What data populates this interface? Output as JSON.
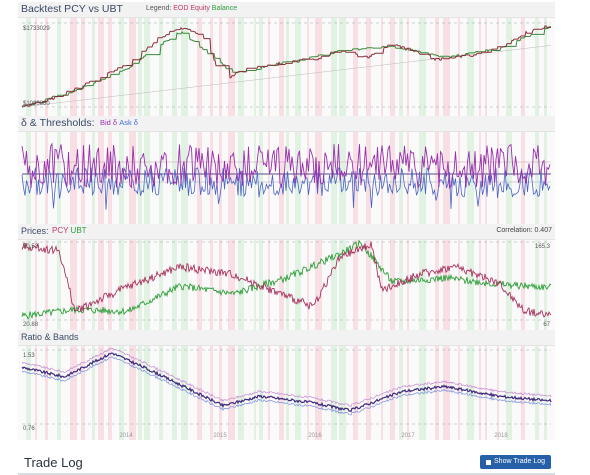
{
  "panels": {
    "backtest": {
      "title": "Backtest PCY vs UBT",
      "legend_prefix": "Legend:",
      "legend_a": "EOD Equity",
      "legend_b": "Balance",
      "top_value": "$1733029",
      "bottom_value": "$1000000"
    },
    "thresholds": {
      "title": "δ & Thresholds:",
      "legend_a": "Bid δ",
      "legend_b": "Ask δ"
    },
    "prices": {
      "title": "Prices:",
      "legend_a": "PCY",
      "legend_b": "UBT",
      "correlation": "Correlation: 0.407",
      "left_top": "30.53",
      "left_bottom": "20.88",
      "right_top": "165.3",
      "right_bottom": "67"
    },
    "ratio": {
      "title": "Ratio & Bands",
      "top_value": "1.53",
      "bottom_value": "0.76"
    }
  },
  "x_axis": {
    "years": [
      "2014",
      "2015",
      "2016",
      "2017",
      "2018"
    ]
  },
  "trade_log": {
    "title": "Trade Log",
    "button": "Show Trade Log"
  },
  "colors": {
    "pcy": "#a8325f",
    "ubt": "#2e9e3a",
    "bid": "#9b2fae",
    "ask": "#4a63c4",
    "equity": "#8b2f3a",
    "balance": "#3a8a3a"
  },
  "chart_data": [
    {
      "type": "line",
      "title": "Backtest PCY vs UBT",
      "series": [
        {
          "name": "EOD Equity",
          "points": [
            [
              0,
              1.0
            ],
            [
              0.05,
              1.06
            ],
            [
              0.12,
              1.2
            ],
            [
              0.2,
              1.38
            ],
            [
              0.26,
              1.62
            ],
            [
              0.3,
              1.71
            ],
            [
              0.34,
              1.65
            ],
            [
              0.36,
              1.45
            ],
            [
              0.38,
              1.24
            ],
            [
              0.42,
              1.33
            ],
            [
              0.5,
              1.4
            ],
            [
              0.56,
              1.44
            ],
            [
              0.6,
              1.51
            ],
            [
              0.65,
              1.44
            ],
            [
              0.7,
              1.56
            ],
            [
              0.74,
              1.5
            ],
            [
              0.78,
              1.42
            ],
            [
              0.85,
              1.46
            ],
            [
              0.9,
              1.53
            ],
            [
              0.95,
              1.66
            ],
            [
              1.0,
              1.73
            ]
          ]
        },
        {
          "name": "Balance",
          "points": [
            [
              0,
              1.0
            ],
            [
              0.1,
              1.15
            ],
            [
              0.2,
              1.35
            ],
            [
              0.3,
              1.68
            ],
            [
              0.4,
              1.3
            ],
            [
              0.5,
              1.4
            ],
            [
              0.6,
              1.5
            ],
            [
              0.7,
              1.54
            ],
            [
              0.8,
              1.44
            ],
            [
              0.9,
              1.52
            ],
            [
              1.0,
              1.73
            ]
          ]
        }
      ]
    },
    {
      "type": "line",
      "title": "δ & Thresholds:",
      "series": [
        {
          "name": "Bid δ",
          "values": []
        },
        {
          "name": "Ask δ",
          "values": []
        }
      ]
    },
    {
      "type": "line",
      "title": "Prices:",
      "correlation": 0.407,
      "series": [
        {
          "name": "PCY",
          "points": [
            [
              0,
              30.0
            ],
            [
              0.07,
              29.5
            ],
            [
              0.1,
              22.0
            ],
            [
              0.2,
              25.0
            ],
            [
              0.3,
              27.5
            ],
            [
              0.4,
              26.5
            ],
            [
              0.55,
              22.5
            ],
            [
              0.6,
              28.5
            ],
            [
              0.66,
              30.3
            ],
            [
              0.68,
              24.5
            ],
            [
              0.75,
              26.5
            ],
            [
              0.82,
              27.5
            ],
            [
              0.9,
              25.5
            ],
            [
              0.95,
              22.0
            ],
            [
              1.0,
              21.5
            ]
          ]
        },
        {
          "name": "UBT",
          "points": [
            [
              0,
              72
            ],
            [
              0.1,
              80
            ],
            [
              0.2,
              78
            ],
            [
              0.3,
              110
            ],
            [
              0.4,
              100
            ],
            [
              0.5,
              120
            ],
            [
              0.6,
              150
            ],
            [
              0.64,
              164
            ],
            [
              0.7,
              115
            ],
            [
              0.8,
              120
            ],
            [
              0.9,
              112
            ],
            [
              1.0,
              108
            ]
          ]
        }
      ]
    },
    {
      "type": "line",
      "title": "Ratio & Bands",
      "ylim": [
        0.76,
        1.53
      ],
      "series": [
        {
          "name": "Ratio",
          "points": [
            [
              0,
              1.35
            ],
            [
              0.08,
              1.25
            ],
            [
              0.17,
              1.5
            ],
            [
              0.25,
              1.3
            ],
            [
              0.38,
              0.95
            ],
            [
              0.45,
              1.05
            ],
            [
              0.55,
              0.98
            ],
            [
              0.62,
              0.9
            ],
            [
              0.72,
              1.1
            ],
            [
              0.8,
              1.15
            ],
            [
              0.9,
              1.05
            ],
            [
              1.0,
              1.0
            ]
          ]
        }
      ]
    }
  ]
}
